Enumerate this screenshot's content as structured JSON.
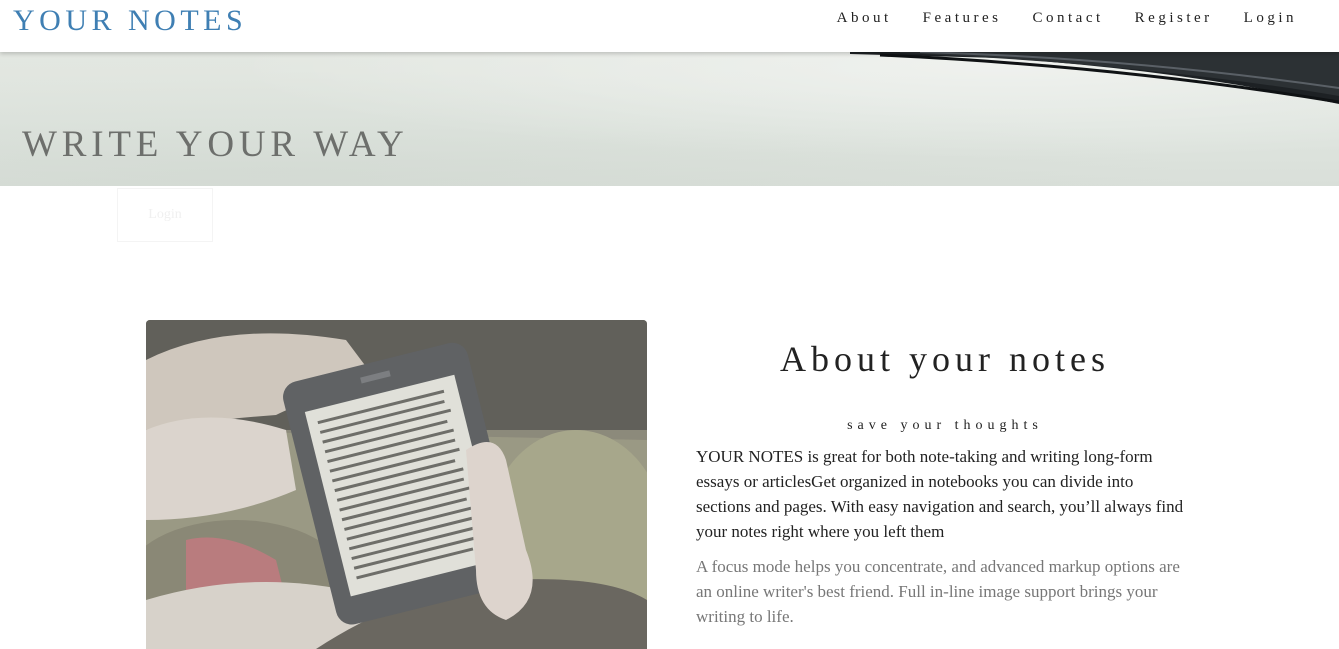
{
  "nav": {
    "brand": "YOUR NOTES",
    "links": [
      "About",
      "Features",
      "Contact",
      "Register",
      "Login"
    ]
  },
  "hero": {
    "title": "WRITE YOUR WAY",
    "button_label": "Login"
  },
  "about": {
    "title": "About your notes",
    "subtitle": "save your thoughts",
    "paragraph1": "YOUR NOTES is great for both note-taking and writing long-form essays or articlesGet organized in notebooks you can divide into sections and pages. With easy navigation and search, you’ll always find your notes right where you left them",
    "paragraph2": "A focus mode helps you concentrate, and advanced markup options are an online writer's best friend. Full in-line image support brings your writing to life."
  },
  "colors": {
    "brand": "#3f7fb3",
    "hero_bg": "#e0e6e0",
    "hero_title": "#6d6f6c",
    "muted_text": "#777777"
  }
}
